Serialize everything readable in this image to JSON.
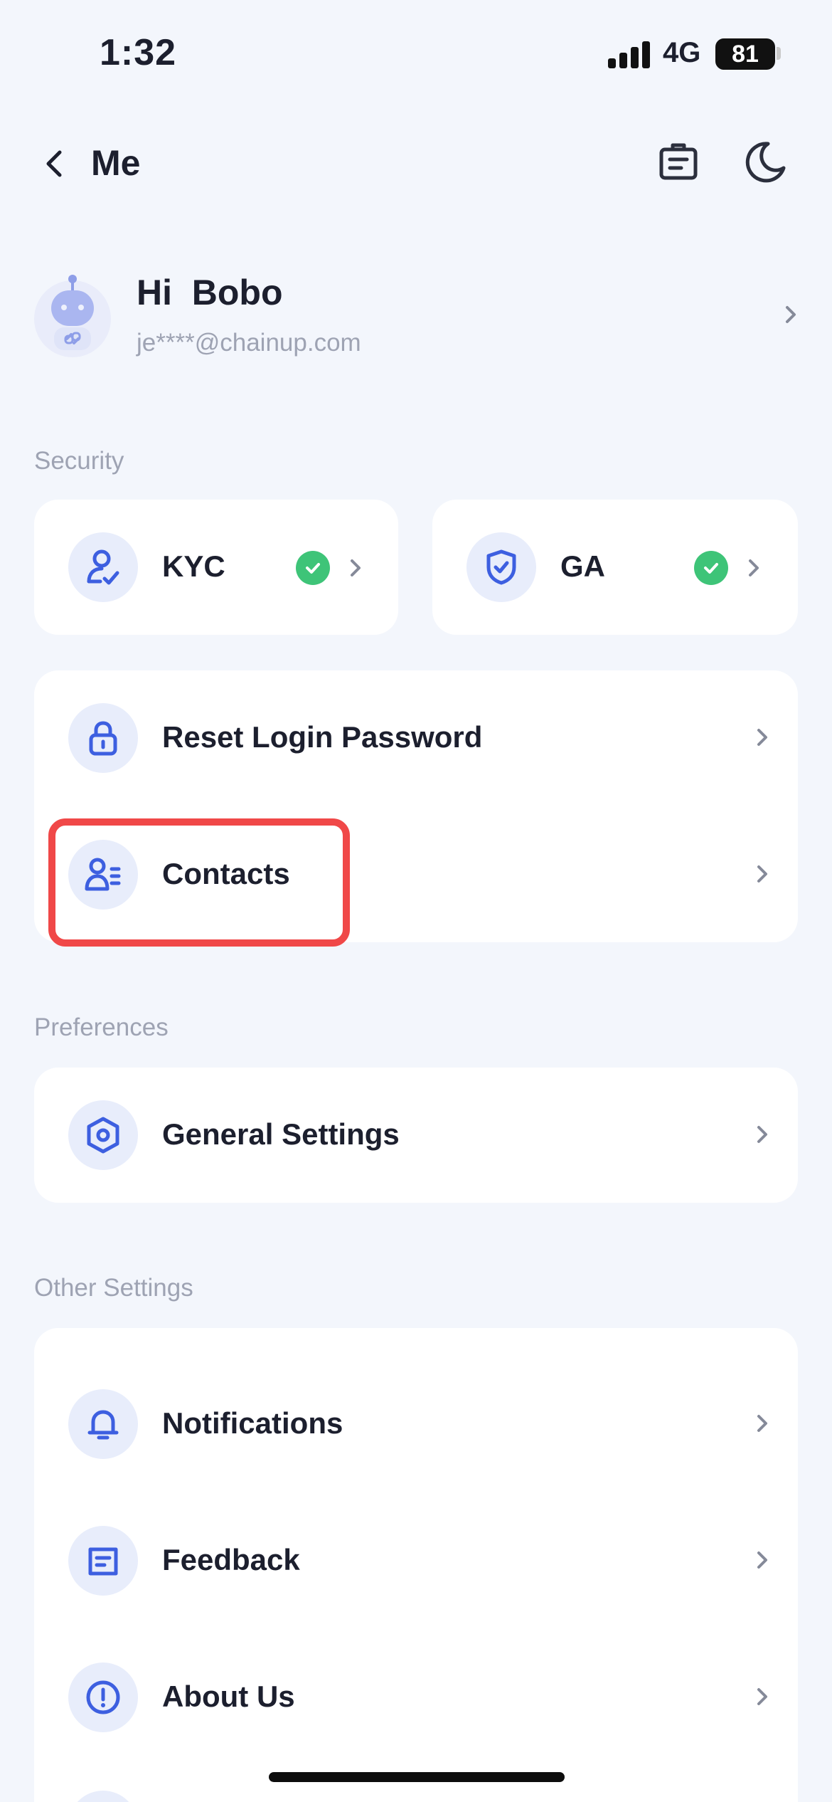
{
  "status": {
    "time": "1:32",
    "network": "4G",
    "battery": "81"
  },
  "header": {
    "title": "Me"
  },
  "profile": {
    "greeting": "Hi  Bobo",
    "email": "je****@chainup.com"
  },
  "security": {
    "label": "Security",
    "kyc": {
      "label": "KYC",
      "verified": true
    },
    "ga": {
      "label": "GA",
      "verified": true
    },
    "items": [
      {
        "label": "Reset Login Password"
      },
      {
        "label": "Contacts"
      }
    ]
  },
  "preferences": {
    "label": "Preferences",
    "items": [
      {
        "label": "General Settings"
      }
    ]
  },
  "other": {
    "label": "Other Settings",
    "items": [
      {
        "label": "Notifications"
      },
      {
        "label": "Feedback"
      },
      {
        "label": "About Us"
      }
    ]
  },
  "colors": {
    "accent": "#3d5fe0",
    "icon_bg": "#e8edfb",
    "check": "#3ec478",
    "highlight": "#f04848",
    "background": "#f3f6fc"
  }
}
